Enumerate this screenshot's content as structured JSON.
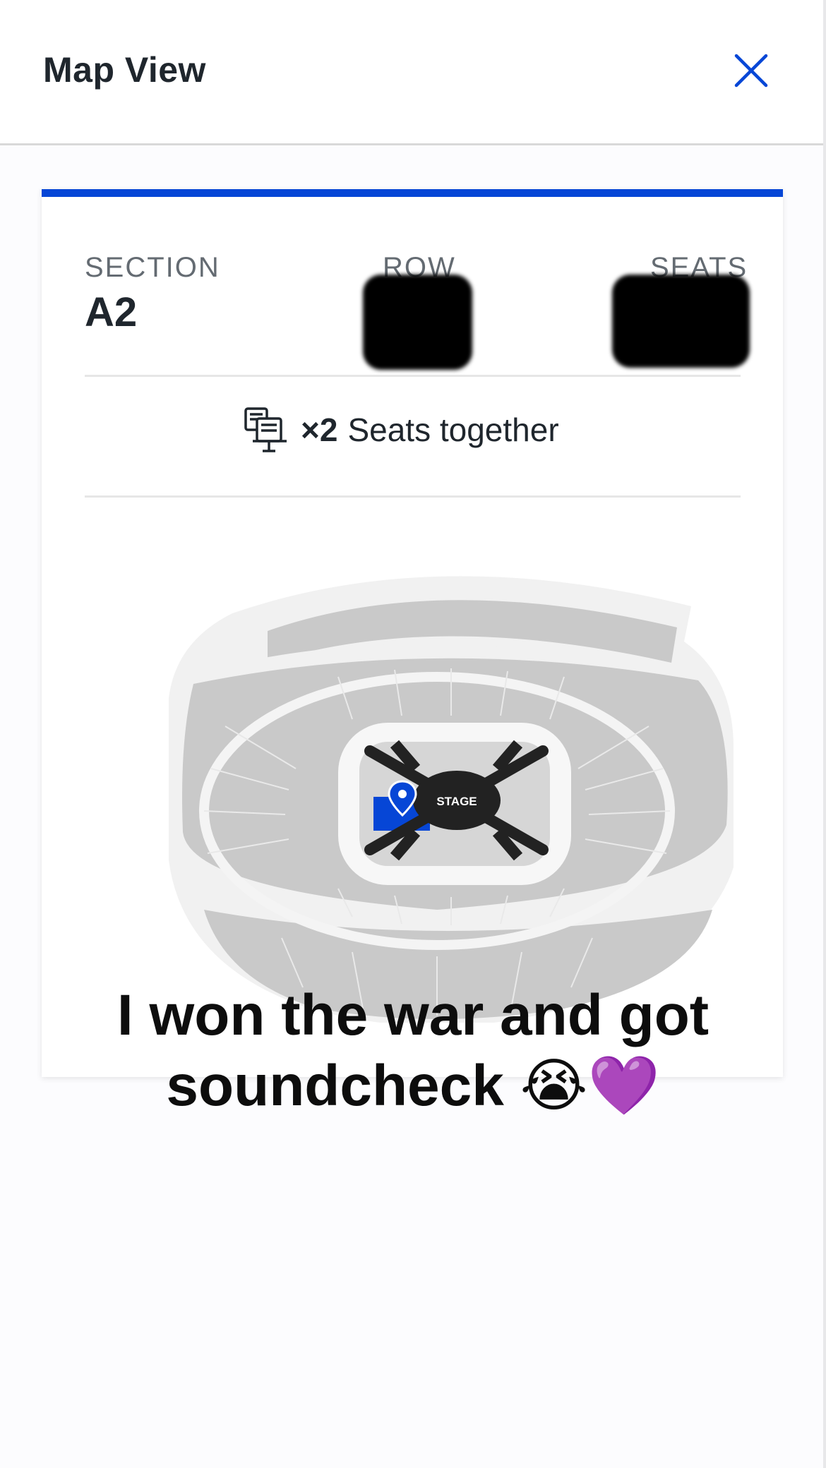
{
  "header": {
    "title": "Map View",
    "close_icon": "close-icon"
  },
  "ticket": {
    "section_label": "SECTION",
    "section_value": "A2",
    "row_label": "ROW",
    "seats_label": "SEATS",
    "together_count": "×2",
    "together_text": "Seats together",
    "together_icon": "seats-together-icon"
  },
  "map": {
    "stage_label": "STAGE",
    "selected_section": "A2",
    "selected_color": "#0646d6",
    "stage_color": "#222222",
    "seat_color": "#c9c9c9"
  },
  "caption": {
    "line1": "I won the war and got",
    "line2": "soundcheck 😭💜"
  },
  "colors": {
    "accent": "#0646d6"
  }
}
